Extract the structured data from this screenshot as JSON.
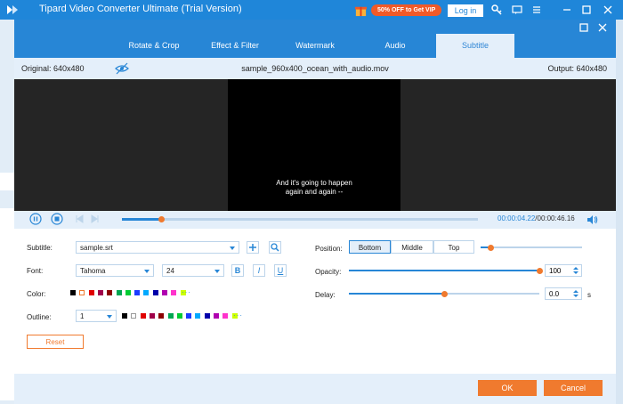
{
  "app": {
    "title": "Tipard Video Converter Ultimate (Trial Version)",
    "promo": "50% OFF to Get VIP",
    "login": "Log in"
  },
  "tabs": [
    {
      "label": "Rotate & Crop"
    },
    {
      "label": "Effect & Filter"
    },
    {
      "label": "Watermark"
    },
    {
      "label": "Audio"
    },
    {
      "label": "Subtitle"
    }
  ],
  "info": {
    "original": "Original: 640x480",
    "filename": "sample_960x400_ocean_with_audio.mov",
    "output": "Output: 640x480"
  },
  "preview": {
    "subtitle_line1": "And it's going to happen",
    "subtitle_line2": "again and again --"
  },
  "playback": {
    "current": "00:00:04.22",
    "duration": "/00:00:46.16",
    "progress": 0.11
  },
  "subtitle": {
    "label": "Subtitle:",
    "value": "sample.srt"
  },
  "font": {
    "label": "Font:",
    "family": "Tahoma",
    "size": "24",
    "bold": "B",
    "italic": "I",
    "underline": "U"
  },
  "color": {
    "label": "Color:",
    "swatches": [
      "#000000",
      "#ffffff",
      "#e00000",
      "#a0004a",
      "#8b0000",
      "#00a651",
      "#00cc33",
      "#1a3cff",
      "#00aaff",
      "#0000aa",
      "#b000b0",
      "#ff33cc",
      "#ccff00"
    ],
    "selected_index": 1,
    "more": "···"
  },
  "outline": {
    "label": "Outline:",
    "value": "1",
    "swatches": [
      "#000000",
      "#ffffff",
      "#e00000",
      "#a0004a",
      "#8b0000",
      "#00a651",
      "#00cc33",
      "#1a3cff",
      "#00aaff",
      "#0000aa",
      "#b000b0",
      "#ff33cc",
      "#ccff00"
    ],
    "more": "···"
  },
  "reset": "Reset",
  "position": {
    "label": "Position:",
    "options": [
      "Bottom",
      "Middle",
      "Top"
    ],
    "selected": "Bottom",
    "offset_fraction": 0.1
  },
  "opacity": {
    "label": "Opacity:",
    "value": "100",
    "fraction": 1.0
  },
  "delay": {
    "label": "Delay:",
    "value": "0.0",
    "unit": "s",
    "fraction": 0.5
  },
  "footer": {
    "ok": "OK",
    "cancel": "Cancel"
  },
  "colors": {
    "accent": "#2786d6",
    "orange": "#f07a2e",
    "promo": "#f05a28"
  }
}
